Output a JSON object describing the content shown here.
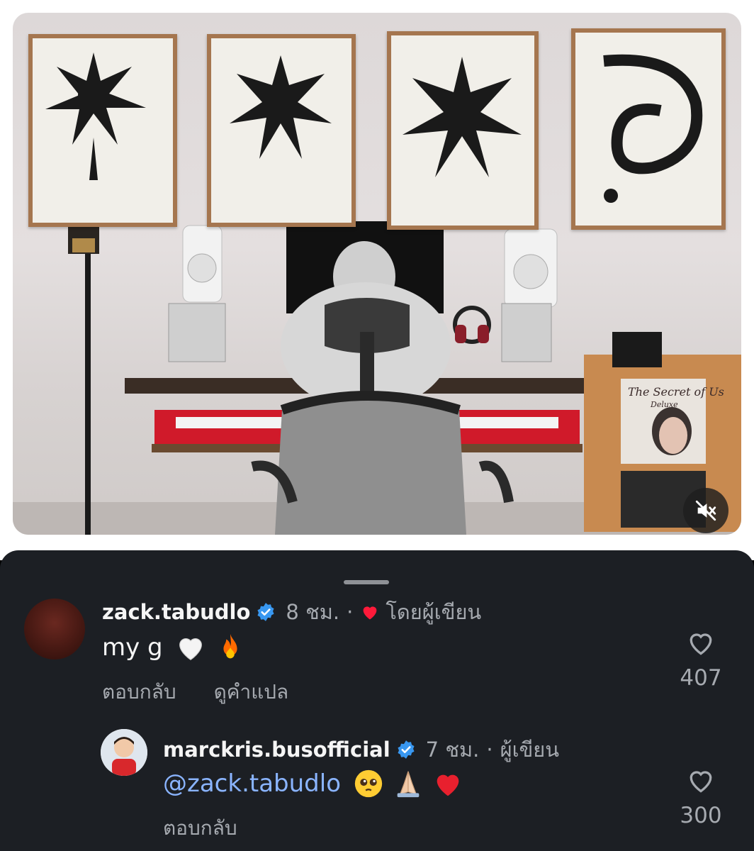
{
  "post": {
    "album_cover_title": "The Secret of Us",
    "album_cover_subtitle": "Deluxe",
    "mute_icon": "speaker-muted-icon"
  },
  "comments": [
    {
      "username": "zack.tabudlo",
      "verified": true,
      "time": "8 ชม.",
      "separator": "·",
      "author_liked_label": "โดยผู้เขียน",
      "text": "my g",
      "emojis": [
        "white-heart-icon",
        "fire-icon"
      ],
      "reply_label": "ตอบกลับ",
      "translate_label": "ดูคำแปล",
      "like_count": "407"
    },
    {
      "username": "marckris.busofficial",
      "verified": true,
      "time": "7 ชม.",
      "separator": "·",
      "author_badge": "ผู้เขียน",
      "mention": "@zack.tabudlo",
      "emojis": [
        "pleading-face-icon",
        "folded-hands-icon",
        "red-heart-icon"
      ],
      "reply_label": "ตอบกลับ",
      "like_count": "300"
    }
  ],
  "colors": {
    "sheet_bg": "#1c1f24",
    "verified_blue": "#3897f0",
    "mention_blue": "#8ab4ff",
    "heart_red": "#ff1a3a",
    "muted_text": "#a6aab0"
  }
}
